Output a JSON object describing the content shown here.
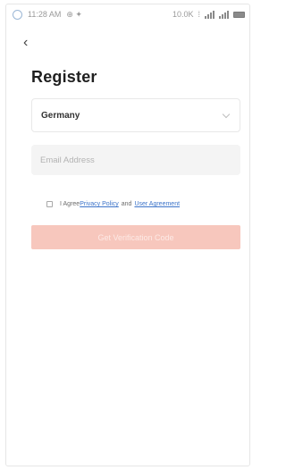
{
  "status_bar": {
    "time": "11:28 AM",
    "left_extras": "⊕ ✦",
    "speed": "10.0K",
    "network": "⁞"
  },
  "page": {
    "back_icon": "chevron-left-icon",
    "title": "Register"
  },
  "country": {
    "value": "Germany"
  },
  "email": {
    "placeholder": "Email Address",
    "value": ""
  },
  "agreement": {
    "prefix": "I Agree",
    "privacy_link": "Privacy Policy",
    "connector": "and",
    "user_link": "User Agreement"
  },
  "actions": {
    "get_code_label": "Get Verification Code",
    "button_color": "#f7c7bd",
    "link_color": "#3d74c9"
  }
}
